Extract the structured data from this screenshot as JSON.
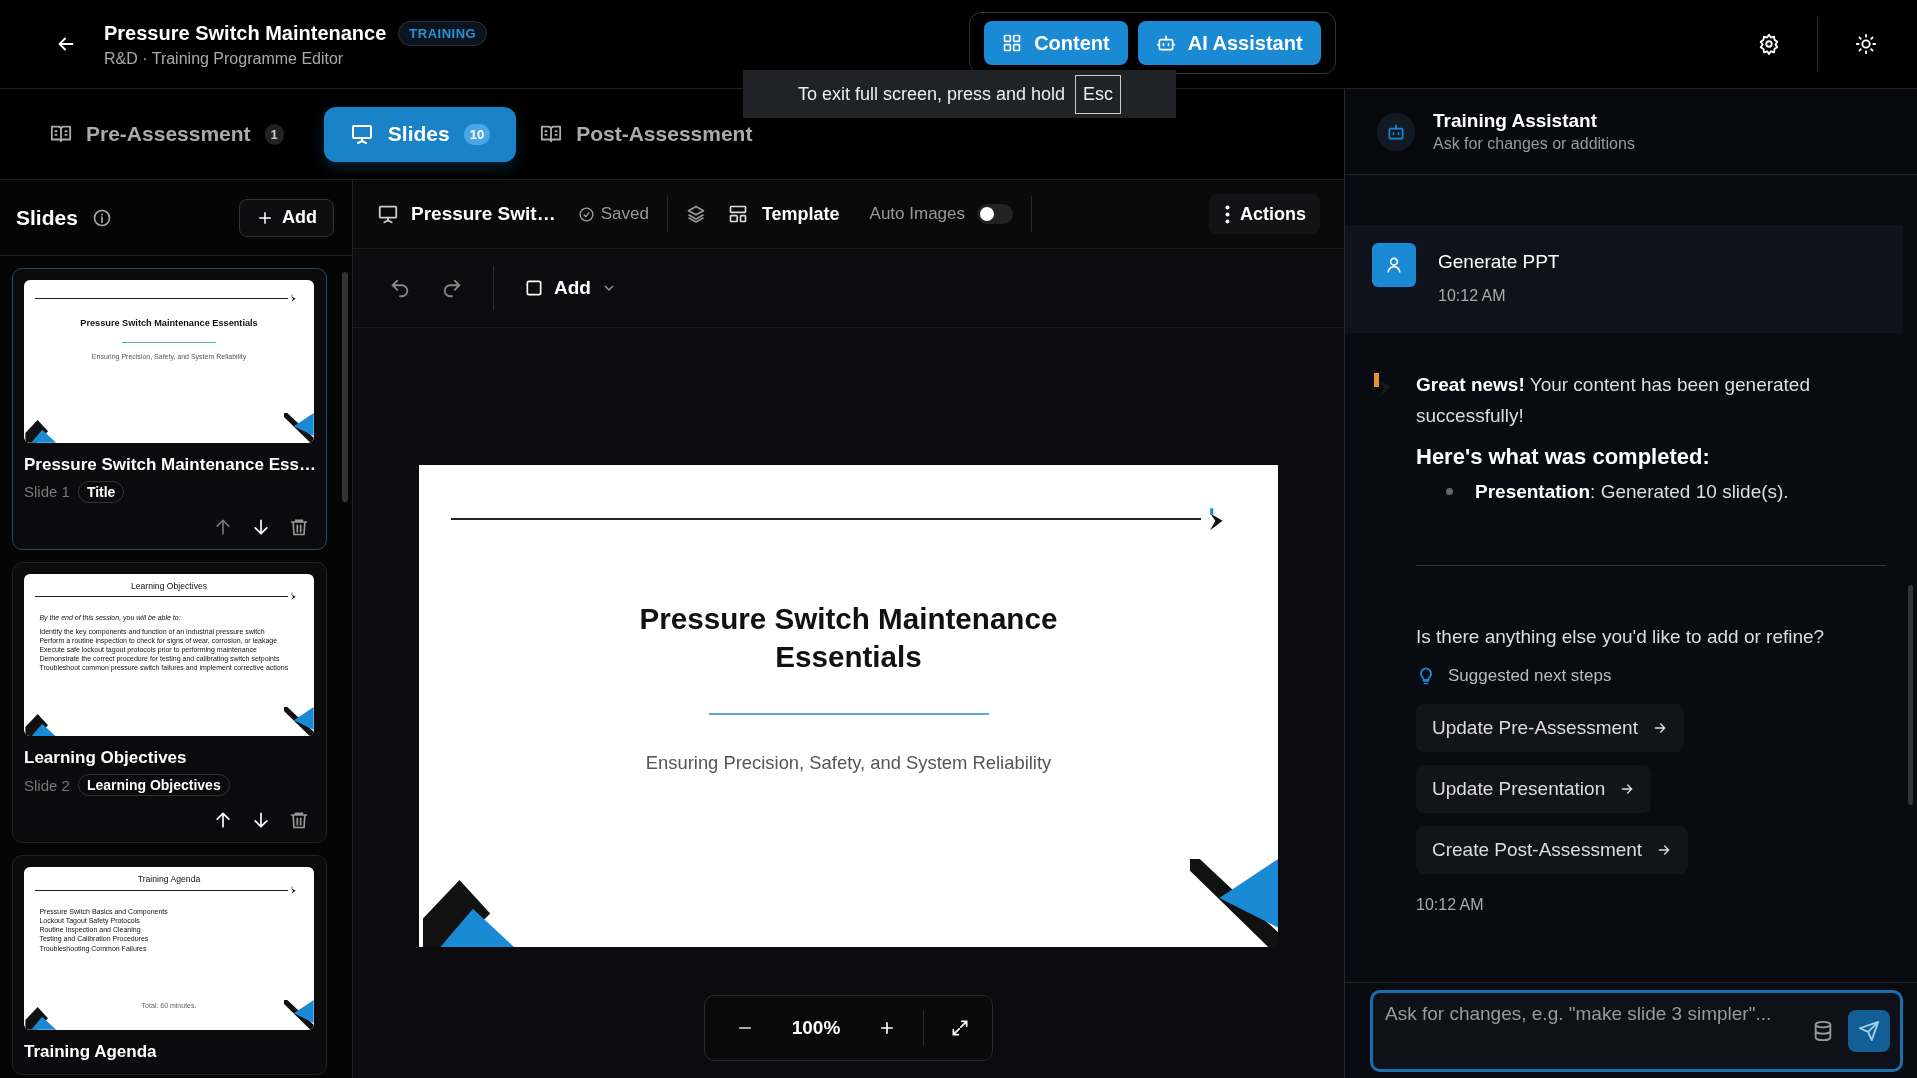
{
  "header": {
    "title": "Pressure Switch Maintenance",
    "badge": "TRAINING",
    "subtitle": "R&D · Training Programme Editor"
  },
  "mode_switch": [
    {
      "label": "Content",
      "kind": "grid"
    },
    {
      "label": "AI Assistant",
      "kind": "bot"
    }
  ],
  "toast": {
    "text": "To exit full screen, press and hold",
    "key": "Esc"
  },
  "tabs": [
    {
      "label": "Pre-Assessment",
      "count": "1",
      "selected": false
    },
    {
      "label": "Slides",
      "count": "10",
      "selected": true
    },
    {
      "label": "Post-Assessment",
      "selected": false
    }
  ],
  "slides_panel": {
    "title": "Slides",
    "add": "Add",
    "slides": [
      {
        "kind": "title",
        "thumb_title": "Pressure Switch Maintenance Essentials",
        "thumb_subtitle": "Ensuring Precision, Safety, and System Reliability",
        "name": "Pressure Switch Maintenance Ess…",
        "number": "Slide 1",
        "tag": "Title",
        "selected": true,
        "up_disabled": true
      },
      {
        "kind": "list",
        "thumb_title": "Learning Objectives",
        "intro": "By the end of this session, you will be able to:",
        "lines": [
          "Identify the key components and function of an industrial pressure switch",
          "Perform a routine inspection to check for signs of wear, corrosion, or leakage",
          "Execute safe lockout tagout protocols prior to performing maintenance",
          "Demonstrate the correct procedure for testing and calibrating switch setpoints",
          "Troubleshoot common pressure switch failures and implement corrective actions"
        ],
        "name": "Learning Objectives",
        "number": "Slide 2",
        "tag": "Learning Objectives",
        "selected": false,
        "up_disabled": false
      },
      {
        "kind": "list",
        "thumb_title": "Training Agenda",
        "lines": [
          "Pressure Switch Basics and Components",
          "Lockout Tagout Safety Protocols",
          "Routine Inspection and Cleaning",
          "Testing and Calibration Procedures",
          "Troubleshooting Common Failures"
        ],
        "footer": "Total: 60 minutes.",
        "name": "Training Agenda",
        "selected": false
      }
    ]
  },
  "editor": {
    "deck_title": "Pressure Swit…",
    "saved": "Saved",
    "template": "Template",
    "auto_images": {
      "label": "Auto Images",
      "on": false
    },
    "actions": "Actions",
    "add": "Add",
    "slide": {
      "title": "Pressure Switch Maintenance Essentials",
      "subtitle": "Ensuring Precision, Safety, and System Reliability"
    },
    "zoom": "100%"
  },
  "assistant": {
    "title": "Training Assistant",
    "subtitle": "Ask for changes or additions",
    "user_message": {
      "text": "Generate PPT",
      "time": "10:12 AM"
    },
    "reply": {
      "intro": "**Great news!** Your content has been generated successfully!",
      "heading": "Here's what was completed:",
      "bullets": [
        "**Presentation**: Generated 10 slide(s)."
      ],
      "question": "Is there anything else you'd like to add or refine?",
      "suggest_label": "Suggested next steps",
      "suggestions": [
        "Update Pre-Assessment",
        "Update Presentation",
        "Create Post-Assessment"
      ],
      "time": "10:12 AM"
    },
    "input": {
      "placeholder": "Ask for changes, e.g. \"make slide 3 simpler\"..."
    }
  }
}
